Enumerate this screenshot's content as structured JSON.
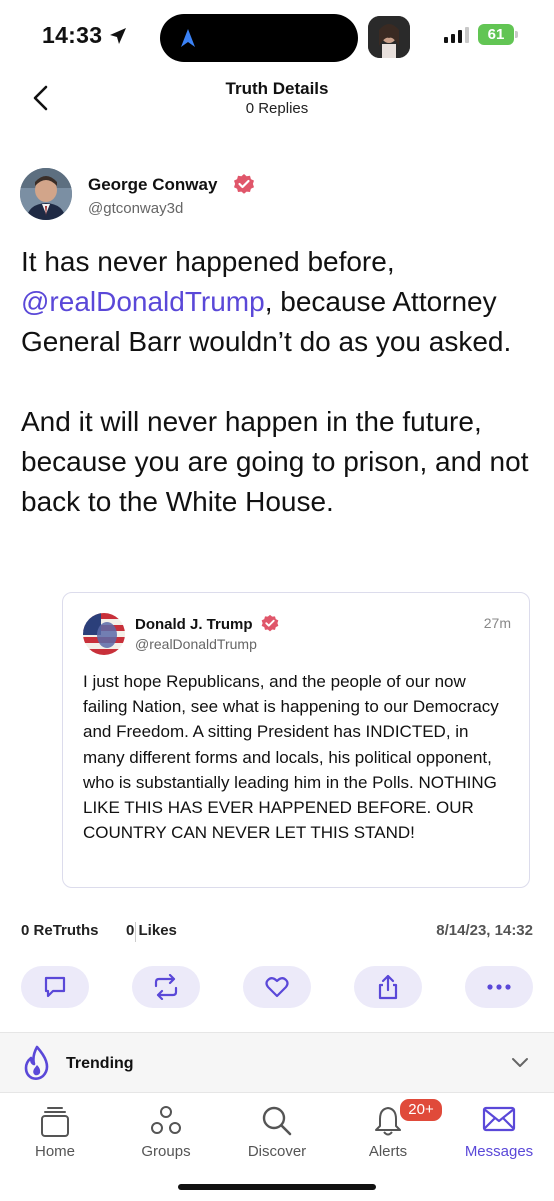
{
  "status_bar": {
    "time": "14:33",
    "battery": "61"
  },
  "header": {
    "title": "Truth Details",
    "subtitle": "0 Replies"
  },
  "post": {
    "author_name": "George Conway",
    "author_handle": "@gtconway3d",
    "text_before_mention": "It has never happened before, ",
    "mention": "@realDonaldTrump",
    "text_after_mention": ", because Attorney General Barr wouldn’t do as you asked.",
    "text_para2": "And it will never happen in the future, because you are going to prison, and not back to the White House."
  },
  "quoted_post": {
    "author_name": "Donald J. Trump",
    "author_handle": "@realDonaldTrump",
    "time": "27m",
    "text": "I just hope Republicans, and the people of our now failing Nation, see what is happening to our Democracy and Freedom. A sitting President has INDICTED, in many different forms and locals, his political opponent, who is substantially leading him in the Polls. NOTHING LIKE THIS HAS EVER HAPPENED BEFORE. OUR COUNTRY CAN NEVER LET THIS STAND!"
  },
  "stats": {
    "retruths_count": "0",
    "retruths_label": "ReTruths",
    "likes_count": "0",
    "likes_label": "Likes",
    "date": "8/14/23, 14:32"
  },
  "actions": [
    "reply-icon",
    "retruth-icon",
    "heart-icon",
    "share-icon",
    "more-icon"
  ],
  "trending": {
    "label": "Trending"
  },
  "tabbar": {
    "tabs": [
      {
        "label": "Home",
        "icon": "home-icon"
      },
      {
        "label": "Groups",
        "icon": "groups-icon"
      },
      {
        "label": "Discover",
        "icon": "search-icon"
      },
      {
        "label": "Alerts",
        "icon": "bell-icon"
      },
      {
        "label": "Messages",
        "icon": "mail-icon"
      }
    ],
    "alerts_badge": "20+"
  },
  "colors": {
    "accent": "#5a48d8",
    "action_bg": "#eceaf9",
    "badge": "#e04a3a"
  }
}
